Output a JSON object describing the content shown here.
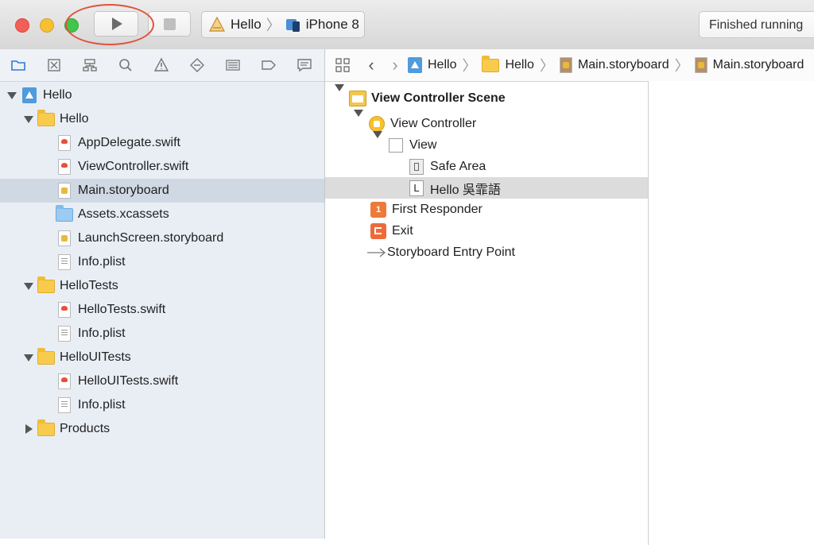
{
  "toolbar": {
    "scheme_target": "Hello",
    "scheme_device": "iPhone 8",
    "status": "Finished running"
  },
  "navigator": {
    "tabs": [
      "folder-icon",
      "x-square-icon",
      "hierarchy-icon",
      "search-icon",
      "warning-icon",
      "diamond-icon",
      "list-icon",
      "tag-icon",
      "message-icon"
    ],
    "tree": [
      {
        "label": "Hello",
        "type": "project",
        "indent": 0,
        "disclosure": "open"
      },
      {
        "label": "Hello",
        "type": "folder",
        "indent": 1,
        "disclosure": "open"
      },
      {
        "label": "AppDelegate.swift",
        "type": "swift",
        "indent": 2
      },
      {
        "label": "ViewController.swift",
        "type": "swift",
        "indent": 2
      },
      {
        "label": "Main.storyboard",
        "type": "storyboard",
        "indent": 2,
        "selected": true
      },
      {
        "label": "Assets.xcassets",
        "type": "assets",
        "indent": 2
      },
      {
        "label": "LaunchScreen.storyboard",
        "type": "storyboard",
        "indent": 2
      },
      {
        "label": "Info.plist",
        "type": "plist",
        "indent": 2
      },
      {
        "label": "HelloTests",
        "type": "folder",
        "indent": 1,
        "disclosure": "open"
      },
      {
        "label": "HelloTests.swift",
        "type": "swift",
        "indent": 2
      },
      {
        "label": "Info.plist",
        "type": "plist",
        "indent": 2
      },
      {
        "label": "HelloUITests",
        "type": "folder",
        "indent": 1,
        "disclosure": "open"
      },
      {
        "label": "HelloUITests.swift",
        "type": "swift",
        "indent": 2
      },
      {
        "label": "Info.plist",
        "type": "plist",
        "indent": 2
      },
      {
        "label": "Products",
        "type": "folder",
        "indent": 1,
        "disclosure": "closed"
      }
    ]
  },
  "jumpbar": {
    "crumbs": [
      {
        "label": "Hello",
        "icon": "project"
      },
      {
        "label": "Hello",
        "icon": "folder"
      },
      {
        "label": "Main.storyboard",
        "icon": "storyboard"
      },
      {
        "label": "Main.storyboard",
        "icon": "storyboard"
      }
    ]
  },
  "outline": [
    {
      "label": "View Controller Scene",
      "icon": "scene",
      "indent": 0,
      "disclosure": "open",
      "bold": true
    },
    {
      "label": "View Controller",
      "icon": "view-controller",
      "indent": 1,
      "disclosure": "open"
    },
    {
      "label": "View",
      "icon": "view",
      "indent": 2,
      "disclosure": "open"
    },
    {
      "label": "Safe Area",
      "icon": "safe-area",
      "indent": 3
    },
    {
      "label": "Hello 吳霏語",
      "icon": "label",
      "indent": 3,
      "selected": true
    },
    {
      "label": "First Responder",
      "icon": "first-responder",
      "indent": 1
    },
    {
      "label": "Exit",
      "icon": "exit",
      "indent": 1
    },
    {
      "label": "Storyboard Entry Point",
      "icon": "arrow",
      "indent": 1
    }
  ],
  "colors": {
    "highlight_ring": "#e0533b",
    "selection": "#cfd8e3",
    "navigator_bg": "#e9eef5"
  }
}
